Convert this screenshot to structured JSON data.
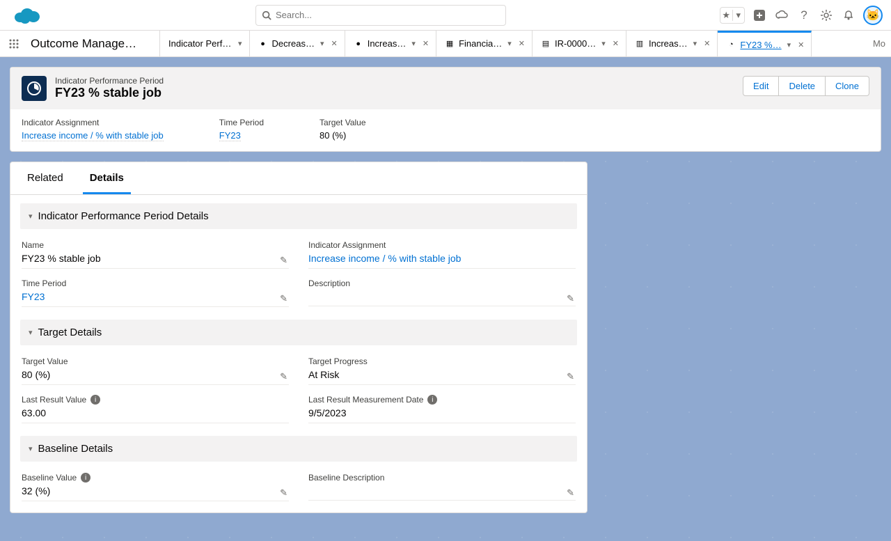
{
  "global": {
    "search_placeholder": "Search...",
    "avatar_emoji": "🐱"
  },
  "appnav": {
    "app_name": "Outcome Manage…",
    "more_label": "Mo"
  },
  "tabs": [
    {
      "label": "Indicator Performance Pe…",
      "icon": "",
      "has_close": false
    },
    {
      "label": "Decreas…",
      "icon": "●",
      "has_close": true
    },
    {
      "label": "Increas…",
      "icon": "●",
      "has_close": true
    },
    {
      "label": "Financia…",
      "icon": "▦",
      "has_close": true
    },
    {
      "label": "IR-0000…",
      "icon": "▤",
      "has_close": true
    },
    {
      "label": "Increas…",
      "icon": "▥",
      "has_close": true
    },
    {
      "label": "FY23 %…",
      "icon": "◔",
      "has_close": true,
      "active": true
    }
  ],
  "record": {
    "object_label": "Indicator Performance Period",
    "title": "FY23 % stable job",
    "actions": {
      "edit": "Edit",
      "delete": "Delete",
      "clone": "Clone"
    },
    "highlights": {
      "indicator_assignment": {
        "label": "Indicator Assignment",
        "value": "Increase income / % with stable job"
      },
      "time_period": {
        "label": "Time Period",
        "value": "FY23"
      },
      "target_value": {
        "label": "Target Value",
        "value": "80 (%)"
      }
    }
  },
  "panel": {
    "tabs": {
      "related": "Related",
      "details": "Details"
    }
  },
  "sections": {
    "s1": {
      "title": "Indicator Performance Period Details",
      "fields": {
        "name": {
          "label": "Name",
          "value": "FY23 % stable job"
        },
        "indicator_assignment": {
          "label": "Indicator Assignment",
          "value": "Increase income / % with stable job"
        },
        "time_period": {
          "label": "Time Period",
          "value": "FY23"
        },
        "description": {
          "label": "Description",
          "value": ""
        }
      }
    },
    "s2": {
      "title": "Target Details",
      "fields": {
        "target_value": {
          "label": "Target Value",
          "value": "80 (%)"
        },
        "target_progress": {
          "label": "Target Progress",
          "value": "At Risk"
        },
        "last_result_value": {
          "label": "Last Result Value",
          "value": "63.00"
        },
        "last_result_date": {
          "label": "Last Result Measurement Date",
          "value": "9/5/2023"
        }
      }
    },
    "s3": {
      "title": "Baseline Details",
      "fields": {
        "baseline_value": {
          "label": "Baseline Value",
          "value": "32 (%)"
        },
        "baseline_description": {
          "label": "Baseline Description",
          "value": ""
        }
      }
    }
  }
}
